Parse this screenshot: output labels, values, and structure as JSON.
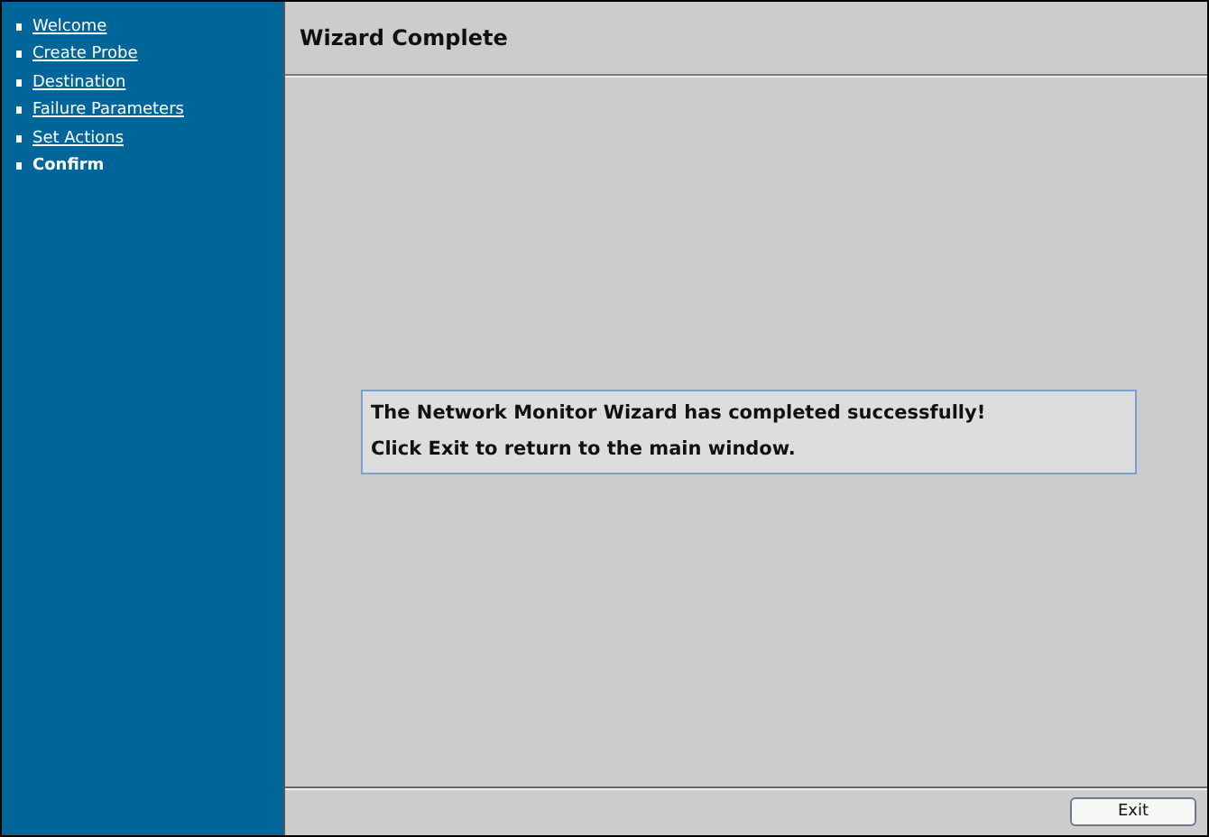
{
  "sidebar": {
    "items": [
      {
        "label": "Welcome",
        "selected": false
      },
      {
        "label": "Create Probe",
        "selected": false
      },
      {
        "label": "Destination",
        "selected": false
      },
      {
        "label": "Failure Parameters",
        "selected": false
      },
      {
        "label": "Set Actions",
        "selected": false
      },
      {
        "label": "Confirm",
        "selected": true
      }
    ]
  },
  "page": {
    "title": "Wizard Complete",
    "messages": [
      "The Network Monitor Wizard has completed successfully!",
      "Click Exit to return to the main window."
    ]
  },
  "buttons": [
    "Exit"
  ]
}
